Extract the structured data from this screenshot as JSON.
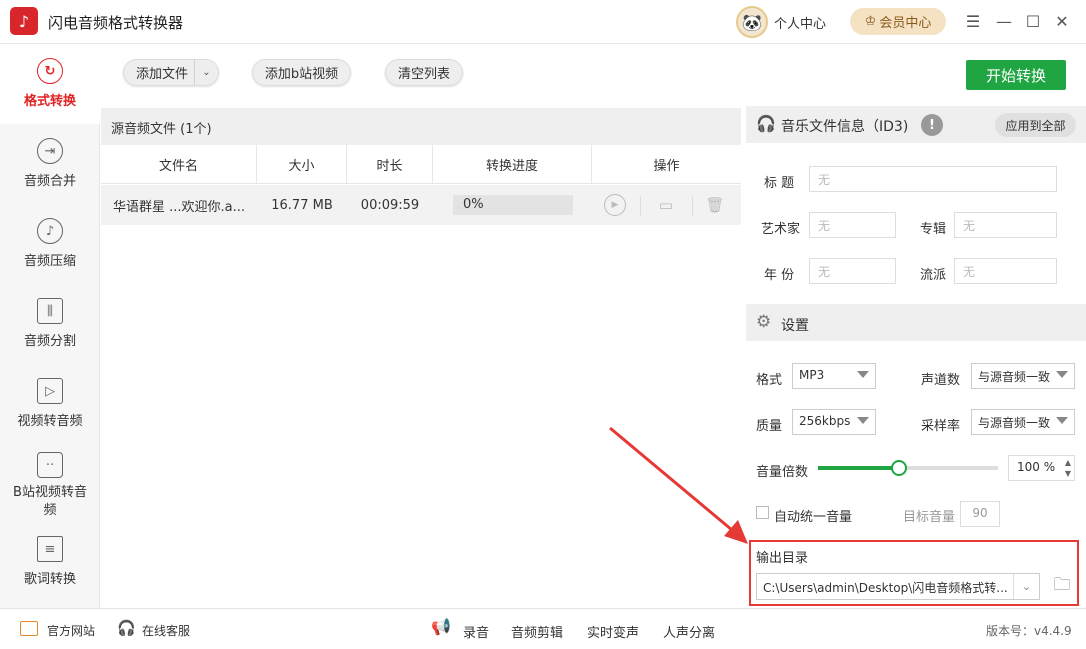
{
  "app": {
    "title": "闪电音频格式转换器",
    "personal": "个人中心",
    "vip": "会员中心",
    "version": "版本号：v4.4.9"
  },
  "sidebar": [
    {
      "label": "格式转换",
      "icon": "refresh-icon",
      "active": true
    },
    {
      "label": "音频合并",
      "icon": "merge-icon"
    },
    {
      "label": "音频压缩",
      "icon": "music-note-icon"
    },
    {
      "label": "音频分割",
      "icon": "split-icon"
    },
    {
      "label": "视频转音频",
      "icon": "video-play-icon"
    },
    {
      "label": "B站视频转音频",
      "icon": "bilibili-tv-icon"
    },
    {
      "label": "歌词转换",
      "icon": "lyrics-doc-icon"
    }
  ],
  "toolbar": {
    "add_file": "添加文件",
    "add_bilibili": "添加b站视频",
    "clear_list": "清空列表",
    "start": "开始转换"
  },
  "files": {
    "header": "源音频文件 (1个)",
    "columns": [
      "文件名",
      "大小",
      "时长",
      "转换进度",
      "操作"
    ],
    "rows": [
      {
        "name": "华语群星 ...欢迎你.a...",
        "size": "16.77 MB",
        "duration": "00:09:59",
        "progress": "0%"
      }
    ]
  },
  "id3": {
    "title": "音乐文件信息（ID3)",
    "apply_all": "应用到全部",
    "title_label": "标  题",
    "title_value": "无",
    "artist_label": "艺术家",
    "artist_value": "无",
    "album_label": "专辑",
    "album_value": "无",
    "year_label": "年  份",
    "year_value": "无",
    "genre_label": "流派",
    "genre_value": "无"
  },
  "settings": {
    "title": "设置",
    "format_label": "格式",
    "format_value": "MP3",
    "channels_label": "声道数",
    "channels_value": "与源音频一致",
    "quality_label": "质量",
    "quality_value": "256kbps",
    "samplerate_label": "采样率",
    "samplerate_value": "与源音频一致",
    "volume_label": "音量倍数",
    "volume_value": "100",
    "volume_unit": "%",
    "volume_fraction": 0.45,
    "auto_volume_label": "自动统一音量",
    "target_volume_label": "目标音量",
    "target_volume_value": "90",
    "output_label": "输出目录",
    "output_path": "C:\\Users\\admin\\Desktop\\闪电音频格式转..."
  },
  "footer": {
    "website": "官方网站",
    "support": "在线客服",
    "record": "录音",
    "edit": "音频剪辑",
    "voice_change": "实时变声",
    "vocal_split": "人声分离"
  },
  "colors": {
    "accent": "#e02424",
    "start": "#1fa542",
    "annotation": "#e53935"
  }
}
